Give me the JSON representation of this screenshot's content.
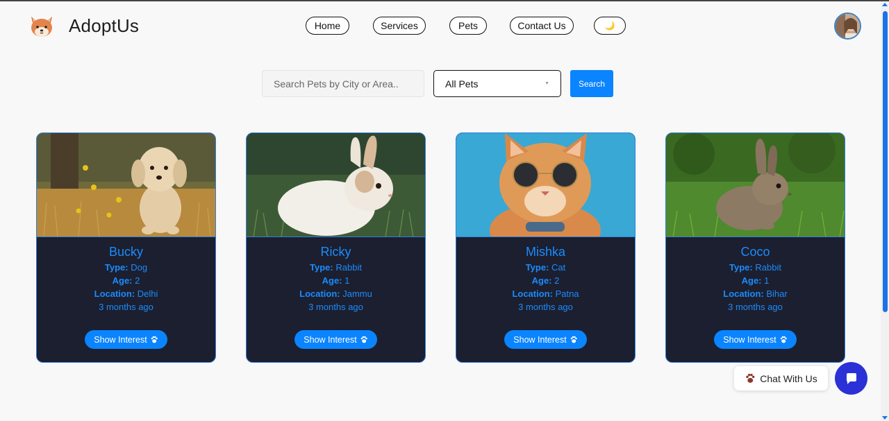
{
  "header": {
    "brand": "AdoptUs",
    "nav": {
      "home": "Home",
      "services": "Services",
      "pets": "Pets",
      "contact": "Contact Us",
      "theme_icon": "🌙"
    },
    "avatar_icon": "user-avatar"
  },
  "search": {
    "placeholder": "Search Pets by City or Area..",
    "filter_selected": "All Pets",
    "button_label": "Search"
  },
  "labels": {
    "type": "Type:",
    "age": "Age:",
    "location": "Location:"
  },
  "pets": [
    {
      "name": "Bucky",
      "type": "Dog",
      "age": "2",
      "location": "Delhi",
      "posted": "3 months ago",
      "button": "Show Interest",
      "image_icon": "dog-photo"
    },
    {
      "name": "Ricky",
      "type": "Rabbit",
      "age": "1",
      "location": "Jammu",
      "posted": "3 months ago",
      "button": "Show Interest",
      "image_icon": "rabbit-photo"
    },
    {
      "name": "Mishka",
      "type": "Cat",
      "age": "2",
      "location": "Patna",
      "posted": "3 months ago",
      "button": "Show Interest",
      "image_icon": "cat-photo"
    },
    {
      "name": "Coco",
      "type": "Rabbit",
      "age": "1",
      "location": "Bihar",
      "posted": "3 months ago",
      "button": "Show Interest",
      "image_icon": "rabbit-photo"
    }
  ],
  "chat": {
    "label": "Chat With Us",
    "icon": "paw-icon",
    "fab_icon": "chat-bubble-icon"
  },
  "colors": {
    "accent": "#0a84ff",
    "card_bg": "#1c1f2f",
    "chat_fab": "#2b31d6"
  }
}
